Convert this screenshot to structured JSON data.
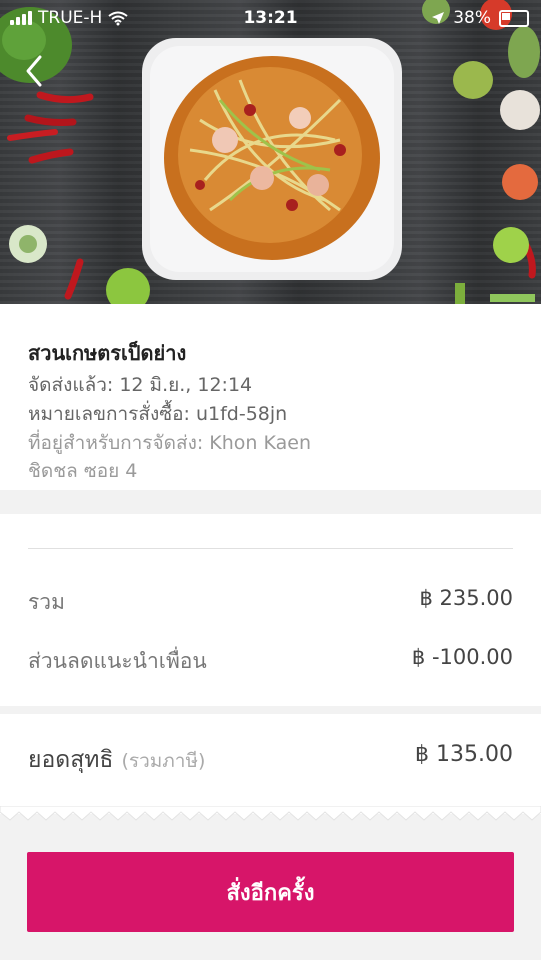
{
  "statusbar": {
    "carrier": "TRUE-H",
    "time": "13:21",
    "battery": "38%"
  },
  "order": {
    "restaurant": "สวนเกษตรเป็ดย่าง",
    "delivered": "จัดส่งแล้ว: 12 มิ.ย., 12:14",
    "order_number": "หมายเลขการสั่งซื้อ: u1fd-58jn",
    "address_line1": "ที่อยู่สำหรับการจัดส่ง: Khon Kaen",
    "address_line2": "ชิดชล ซอย 4"
  },
  "summary": {
    "subtotal_label": "รวม",
    "subtotal_amount": "฿ 235.00",
    "discount_label": "ส่วนลดแนะนำเพื่อน",
    "discount_amount": "฿ -100.00"
  },
  "total": {
    "label": "ยอดสุทธิ",
    "tax_note": "(รวมภาษี)",
    "amount": "฿ 135.00"
  },
  "actions": {
    "reorder_label": "สั่งอีกครั้ง"
  },
  "colors": {
    "accent": "#d71569"
  },
  "icons": [
    "back-icon",
    "signal-icon",
    "wifi-icon",
    "location-icon",
    "battery-icon"
  ]
}
